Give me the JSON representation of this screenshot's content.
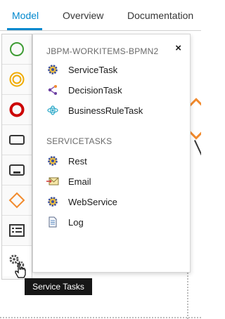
{
  "tabs": [
    {
      "label": "Model"
    },
    {
      "label": "Overview"
    },
    {
      "label": "Documentation"
    }
  ],
  "palette": {
    "items": [
      {
        "icon": "start-event-icon"
      },
      {
        "icon": "intermediate-event-icon"
      },
      {
        "icon": "end-event-icon"
      },
      {
        "icon": "task-icon"
      },
      {
        "icon": "subprocess-icon"
      },
      {
        "icon": "gateway-icon"
      },
      {
        "icon": "lane-icon"
      },
      {
        "icon": "service-tasks-gear-icon"
      }
    ],
    "tooltip": "Service Tasks"
  },
  "flyout": {
    "close": "×",
    "groups": [
      {
        "title": "JBPM-WORKITEMS-BPMN2",
        "items": [
          {
            "label": "ServiceTask",
            "icon": "gear-icon"
          },
          {
            "label": "DecisionTask",
            "icon": "decision-icon"
          },
          {
            "label": "BusinessRuleTask",
            "icon": "business-rule-icon"
          }
        ]
      },
      {
        "title": "SERVICETASKS",
        "items": [
          {
            "label": "Rest",
            "icon": "gear-icon"
          },
          {
            "label": "Email",
            "icon": "email-icon"
          },
          {
            "label": "WebService",
            "icon": "gear-icon"
          },
          {
            "label": "Log",
            "icon": "document-icon"
          }
        ]
      }
    ]
  },
  "colors": {
    "accent": "#0088ce",
    "start_event": "#3f9c35",
    "intermediate_event": "#f0ab00",
    "end_event": "#cc0000",
    "gateway": "#f28b2e"
  }
}
